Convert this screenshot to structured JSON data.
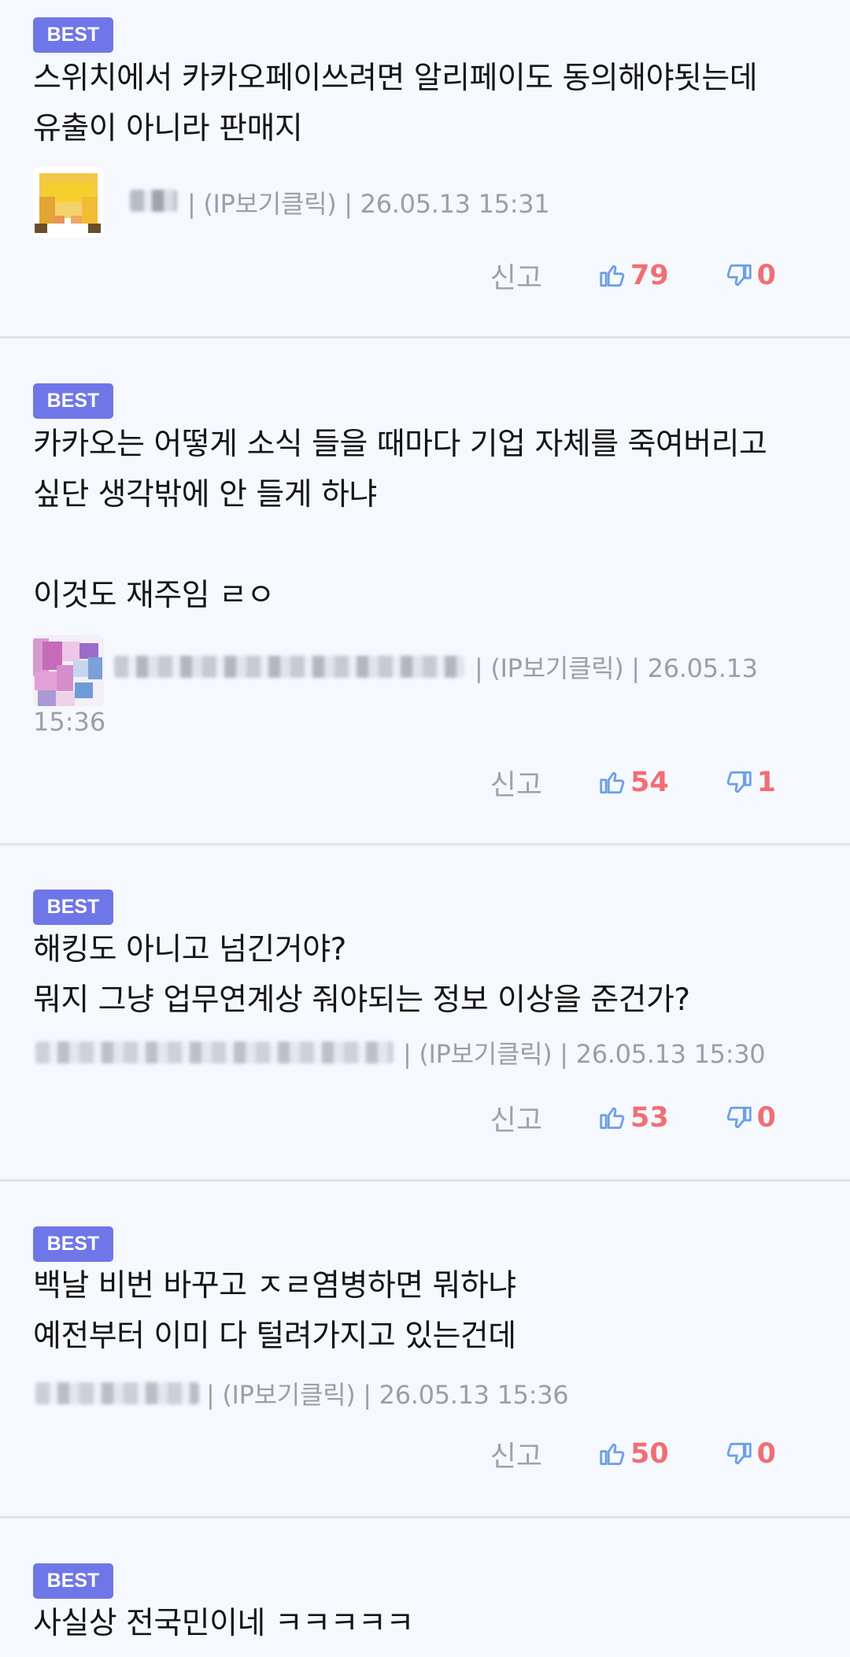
{
  "colors": {
    "badge": "#6f76e8",
    "count": "#f06e74",
    "thumb": "#6f9fe6",
    "meta": "#9a9fa7",
    "background": "#f5f8fc"
  },
  "comments": [
    {
      "badge": "BEST",
      "text": "스위치에서 카카오페이쓰려면 알리페이도 동의해야됫는데\n유출이 아니라 판매지",
      "meta": "| (IP보기클릭) | 26.05.13 15:31",
      "report": "신고",
      "likes": "79",
      "dislikes": "0"
    },
    {
      "badge": "BEST",
      "text": "카카오는 어떻게 소식 들을 때마다 기업 자체를 죽여버리고\n싶단 생각밖에 안 들게 하냐\n\n이것도 재주임 ㄹㅇ",
      "meta": "| (IP보기클릭) | 26.05.13",
      "time_cont": "15:36",
      "report": "신고",
      "likes": "54",
      "dislikes": "1"
    },
    {
      "badge": "BEST",
      "text": "해킹도 아니고 넘긴거야?\n뭐지 그냥 업무연계상 줘야되는 정보 이상을 준건가?",
      "meta": "| (IP보기클릭) | 26.05.13 15:30",
      "report": "신고",
      "likes": "53",
      "dislikes": "0"
    },
    {
      "badge": "BEST",
      "text": "백날 비번 바꾸고 ㅈㄹ염병하면 뭐하냐\n예전부터 이미 다 털려가지고 있는건데",
      "meta": "| (IP보기클릭) | 26.05.13 15:36",
      "report": "신고",
      "likes": "50",
      "dislikes": "0"
    },
    {
      "badge": "BEST",
      "text": "사실상 전국민이네 ㅋㅋㅋㅋㅋ"
    }
  ]
}
